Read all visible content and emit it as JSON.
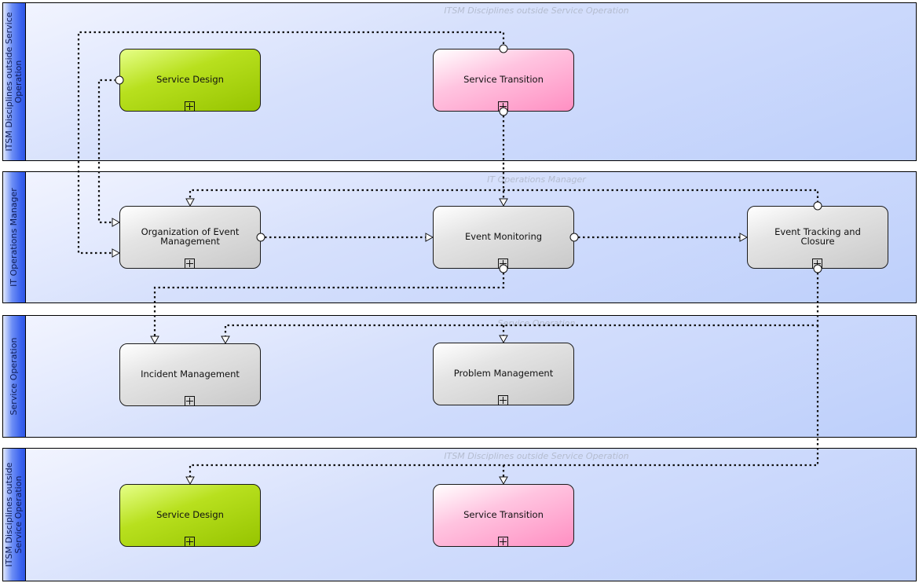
{
  "diagram": {
    "lanes": [
      {
        "id": "lane-1",
        "label": "ITSM Disciplines outside Service\nOperation",
        "watermark": "ITSM Disciplines outside Service Operation"
      },
      {
        "id": "lane-2",
        "label": "IT Operations Manager",
        "watermark": "IT Operations Manager"
      },
      {
        "id": "lane-3",
        "label": "Service Operation",
        "watermark": "Service Operation"
      },
      {
        "id": "lane-4",
        "label": "ITSM Disciplines outside\nService Operation",
        "watermark": "ITSM Disciplines outside Service Operation"
      }
    ],
    "tasks": [
      {
        "id": "service-design-top",
        "label": "Service Design",
        "color": "green",
        "lane": "lane-1"
      },
      {
        "id": "service-transition-top",
        "label": "Service Transition",
        "color": "pink",
        "lane": "lane-1"
      },
      {
        "id": "organization-event-mgmt",
        "label": "Organization of Event Management",
        "color": "gray",
        "lane": "lane-2"
      },
      {
        "id": "event-monitoring",
        "label": "Event Monitoring",
        "color": "gray",
        "lane": "lane-2"
      },
      {
        "id": "event-tracking-closure",
        "label": "Event Tracking and Closure",
        "color": "gray",
        "lane": "lane-2"
      },
      {
        "id": "incident-management",
        "label": "Incident Management",
        "color": "gray",
        "lane": "lane-3"
      },
      {
        "id": "problem-management",
        "label": "Problem Management",
        "color": "gray",
        "lane": "lane-3"
      },
      {
        "id": "service-design-bottom",
        "label": "Service Design",
        "color": "green",
        "lane": "lane-4"
      },
      {
        "id": "service-transition-bottom",
        "label": "Service Transition",
        "color": "pink",
        "lane": "lane-4"
      }
    ],
    "flows": [
      {
        "from": "service-transition-top",
        "to": "organization-event-mgmt",
        "type": "message"
      },
      {
        "from": "service-design-top",
        "to": "organization-event-mgmt",
        "type": "message"
      },
      {
        "from": "service-transition-top",
        "to": "event-monitoring",
        "type": "message"
      },
      {
        "from": "organization-event-mgmt",
        "to": "event-monitoring",
        "type": "message"
      },
      {
        "from": "event-monitoring",
        "to": "event-tracking-closure",
        "type": "message"
      },
      {
        "from": "event-tracking-closure",
        "to": "organization-event-mgmt",
        "type": "message"
      },
      {
        "from": "event-monitoring",
        "to": "incident-management",
        "type": "message"
      },
      {
        "from": "event-tracking-closure",
        "to": "incident-management",
        "type": "message"
      },
      {
        "from": "event-tracking-closure",
        "to": "problem-management",
        "type": "message"
      },
      {
        "from": "event-tracking-closure",
        "to": "service-design-bottom",
        "type": "message"
      },
      {
        "from": "event-tracking-closure",
        "to": "service-transition-bottom",
        "type": "message"
      }
    ],
    "colors": {
      "green": "#a6d30c",
      "pink": "#ffa6cf",
      "gray": "#d3d3d3",
      "lane_label": "#3b63ee",
      "lane_fill": "#d6e0fc"
    }
  }
}
